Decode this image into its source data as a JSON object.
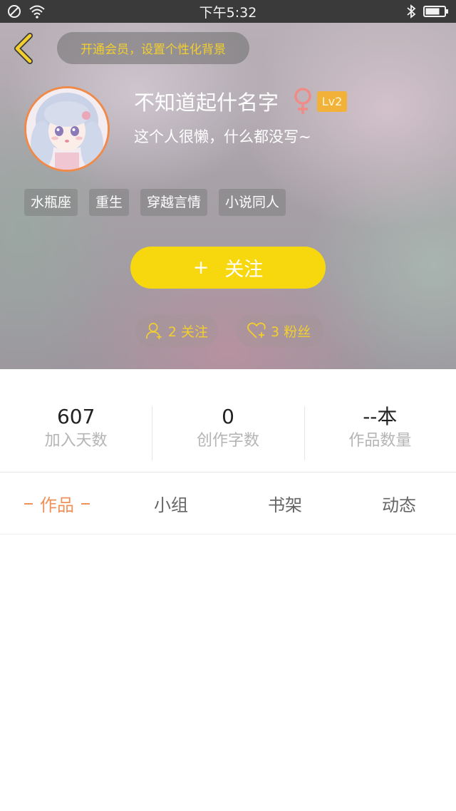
{
  "status_bar": {
    "time": "下午5:32",
    "icons": [
      "no-sim-icon",
      "wifi-icon",
      "bluetooth-icon",
      "battery-icon"
    ]
  },
  "header": {
    "back_icon": "chevron-left-icon",
    "vip_prompt": "开通会员，设置个性化背景",
    "username": "不知道起什名字",
    "gender_icon": "female-icon",
    "level": "Lv2",
    "bio": "这个人很懒，什么都没写~",
    "tags": [
      "水瓶座",
      "重生",
      "穿越言情",
      "小说同人"
    ],
    "follow_button": {
      "icon": "+",
      "label": "关注"
    },
    "following": "2 关注",
    "fans": "3 粉丝"
  },
  "stats": [
    {
      "value": "607",
      "label": "加入天数"
    },
    {
      "value": "0",
      "label": "创作字数"
    },
    {
      "value": "--本",
      "label": "作品数量"
    }
  ],
  "tabs": [
    {
      "label": "作品",
      "active": true
    },
    {
      "label": "小组",
      "active": false
    },
    {
      "label": "书架",
      "active": false
    },
    {
      "label": "动态",
      "active": false
    }
  ],
  "colors": {
    "accent_yellow": "#f7d80f",
    "vip_text": "#f3cf2e",
    "active_tab": "#f08a4a",
    "level_badge": "#f2b23a"
  }
}
